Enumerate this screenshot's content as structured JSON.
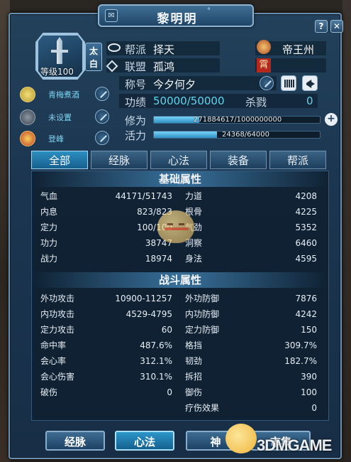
{
  "window": {
    "title": "黎明明",
    "title_mark": "°",
    "help_label": "?",
    "close_label": "✕"
  },
  "profile": {
    "level_text": "等级100",
    "sect_tag": "太白",
    "fields": {
      "sect_key": "帮派",
      "sect_val": "择天",
      "alliance_key": "联盟",
      "alliance_val": "孤鸿",
      "region_val": "帝王州",
      "region_badge": "霄",
      "title_key": "称号",
      "title_val": "今夕何夕",
      "merit_key": "功绩",
      "merit_val": "50000/50000",
      "kill_key": "杀戮",
      "kill_val": "0"
    },
    "cultivation": {
      "key": "修为",
      "text": "271884617/1000000000",
      "fraction": 0.2719
    },
    "vitality": {
      "key": "活力",
      "text": "24368/64000",
      "fraction": 0.3808
    }
  },
  "side_items": [
    {
      "label": "青梅煮酒",
      "icon": "wine-icon"
    },
    {
      "label": "未设置",
      "icon": "pet-icon"
    },
    {
      "label": "登峰",
      "icon": "rank-badge-icon"
    }
  ],
  "tabs": [
    "全部",
    "经脉",
    "心法",
    "装备",
    "帮派"
  ],
  "basic": {
    "header": "基础属性",
    "left": [
      {
        "label": "气血",
        "value": "44171/51743"
      },
      {
        "label": "内息",
        "value": "823/823"
      },
      {
        "label": "定力",
        "value": "100/100"
      },
      {
        "label": "功力",
        "value": "38747"
      },
      {
        "label": "战力",
        "value": "18974"
      }
    ],
    "right": [
      {
        "label": "力道",
        "value": "4208"
      },
      {
        "label": "根骨",
        "value": "4225"
      },
      {
        "label": "气劲",
        "value": "5352"
      },
      {
        "label": "洞察",
        "value": "6460"
      },
      {
        "label": "身法",
        "value": "4595"
      }
    ]
  },
  "combat": {
    "header": "战斗属性",
    "left": [
      {
        "label": "外功攻击",
        "value": "10900-11257"
      },
      {
        "label": "内功攻击",
        "value": "4529-4795"
      },
      {
        "label": "定力攻击",
        "value": "60"
      },
      {
        "label": "命中率",
        "value": "487.6%"
      },
      {
        "label": "会心率",
        "value": "312.1%"
      },
      {
        "label": "会心伤害",
        "value": "310.1%"
      },
      {
        "label": "破伤",
        "value": "0"
      }
    ],
    "right": [
      {
        "label": "外功防御",
        "value": "7876"
      },
      {
        "label": "内功防御",
        "value": "4242"
      },
      {
        "label": "定力防御",
        "value": "150"
      },
      {
        "label": "格挡",
        "value": "309.7%"
      },
      {
        "label": "韧劲",
        "value": "182.7%"
      },
      {
        "label": "拆招",
        "value": "390"
      },
      {
        "label": "御伤",
        "value": "100"
      },
      {
        "label": "疗伤效果",
        "value": "0"
      }
    ]
  },
  "bottom_buttons": [
    "经脉",
    "心法",
    "神",
    "市集"
  ],
  "watermark": "3DMGAME"
}
